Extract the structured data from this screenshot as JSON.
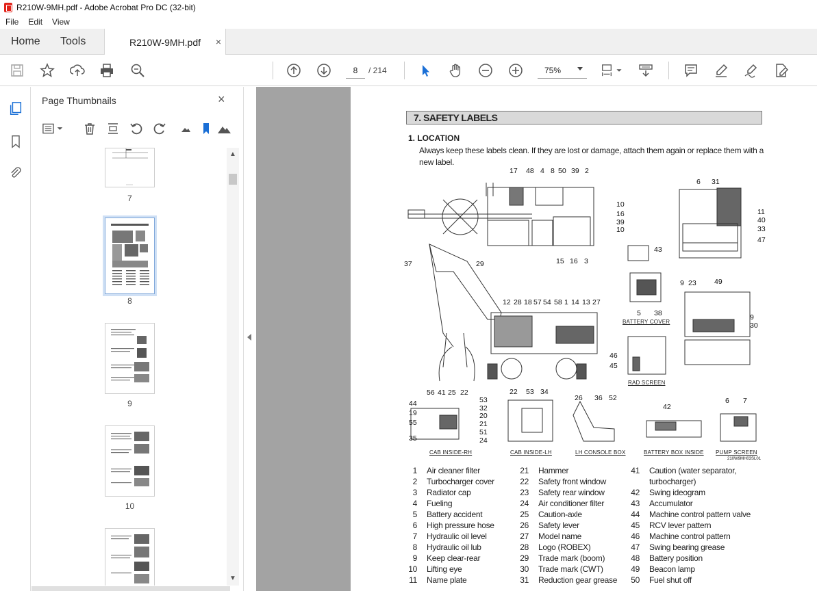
{
  "window": {
    "title": "R210W-9MH.pdf - Adobe Acrobat Pro DC (32-bit)"
  },
  "menu": [
    "File",
    "Edit",
    "View"
  ],
  "tabs": {
    "home": "Home",
    "tools": "Tools",
    "document": "R210W-9MH.pdf",
    "close": "×"
  },
  "toolbar": {
    "current_page": "8",
    "page_total": "/ 214",
    "zoom": "75%"
  },
  "panel": {
    "title": "Page Thumbnails",
    "close": "×",
    "pages": [
      "7",
      "8",
      "9",
      "10"
    ]
  },
  "document": {
    "section_title": "7. SAFETY LABELS",
    "subsection": "1.  LOCATION",
    "paragraph": "Always keep these labels clean.  If they are lost or damage, attach them again or replace them with a new label.",
    "captions": {
      "battery_cover": "BATTERY COVER",
      "rad_screen": "RAD SCREEN",
      "cab_rh": "CAB INSIDE-RH",
      "cab_lh": "CAB INSIDE-LH",
      "lh_console": "LH CONSOLE BOX",
      "battery_box": "BATTERY BOX INSIDE",
      "pump_screen": "PUMP SCREEN",
      "figcode": "210W9MH03SL01"
    },
    "callouts": {
      "top": [
        "17",
        "48",
        "4",
        "8",
        "50",
        "39",
        "2"
      ],
      "right_side": [
        "10",
        "16",
        "39",
        "10"
      ],
      "bottom_top": [
        "15",
        "16",
        "3"
      ],
      "rear": [
        "6",
        "31",
        "11",
        "40",
        "33",
        "47"
      ],
      "plate": [
        "43"
      ],
      "boom": [
        "37",
        "29"
      ],
      "cab": [
        "12",
        "28",
        "18",
        "57",
        "54",
        "58",
        "1",
        "14",
        "13",
        "27"
      ],
      "battery": [
        "5",
        "38"
      ],
      "engine": [
        "9",
        "23",
        "49",
        "9",
        "30"
      ],
      "rad": [
        "46",
        "45"
      ],
      "cabrh": [
        "56",
        "41",
        "25",
        "22",
        "53",
        "32",
        "20",
        "21",
        "51",
        "24",
        "44",
        "19",
        "55",
        "35"
      ],
      "cablh": [
        "22",
        "53",
        "34"
      ],
      "console": [
        "26",
        "36",
        "52"
      ],
      "batbox": [
        "42"
      ],
      "pump": [
        "6",
        "7"
      ]
    },
    "legend": [
      [
        [
          "1",
          "Air cleaner filter"
        ],
        [
          "2",
          "Turbocharger cover"
        ],
        [
          "3",
          "Radiator cap"
        ],
        [
          "4",
          "Fueling"
        ],
        [
          "5",
          "Battery accident"
        ],
        [
          "6",
          "High pressure hose"
        ],
        [
          "7",
          "Hydraulic oil level"
        ],
        [
          "8",
          "Hydraulic oil lub"
        ],
        [
          "9",
          "Keep clear-rear"
        ],
        [
          "10",
          "Lifting eye"
        ],
        [
          "11",
          "Name plate"
        ]
      ],
      [
        [
          "21",
          "Hammer"
        ],
        [
          "22",
          "Safety front window"
        ],
        [
          "23",
          "Safety rear window"
        ],
        [
          "24",
          "Air conditioner filter"
        ],
        [
          "25",
          "Caution-axle"
        ],
        [
          "26",
          "Safety lever"
        ],
        [
          "27",
          "Model name"
        ],
        [
          "28",
          "Logo (ROBEX)"
        ],
        [
          "29",
          "Trade mark (boom)"
        ],
        [
          "30",
          "Trade mark (CWT)"
        ],
        [
          "31",
          "Reduction gear grease"
        ]
      ],
      [
        [
          "41",
          "Caution (water separator,"
        ],
        [
          "",
          "turbocharger)"
        ],
        [
          "42",
          "Swing ideogram"
        ],
        [
          "43",
          "Accumulator"
        ],
        [
          "44",
          "Machine control pattern valve"
        ],
        [
          "45",
          "RCV lever pattern"
        ],
        [
          "46",
          "Machine control pattern"
        ],
        [
          "47",
          "Swing bearing grease"
        ],
        [
          "48",
          "Battery position"
        ],
        [
          "49",
          "Beacon lamp"
        ],
        [
          "50",
          "Fuel shut off"
        ]
      ]
    ]
  }
}
